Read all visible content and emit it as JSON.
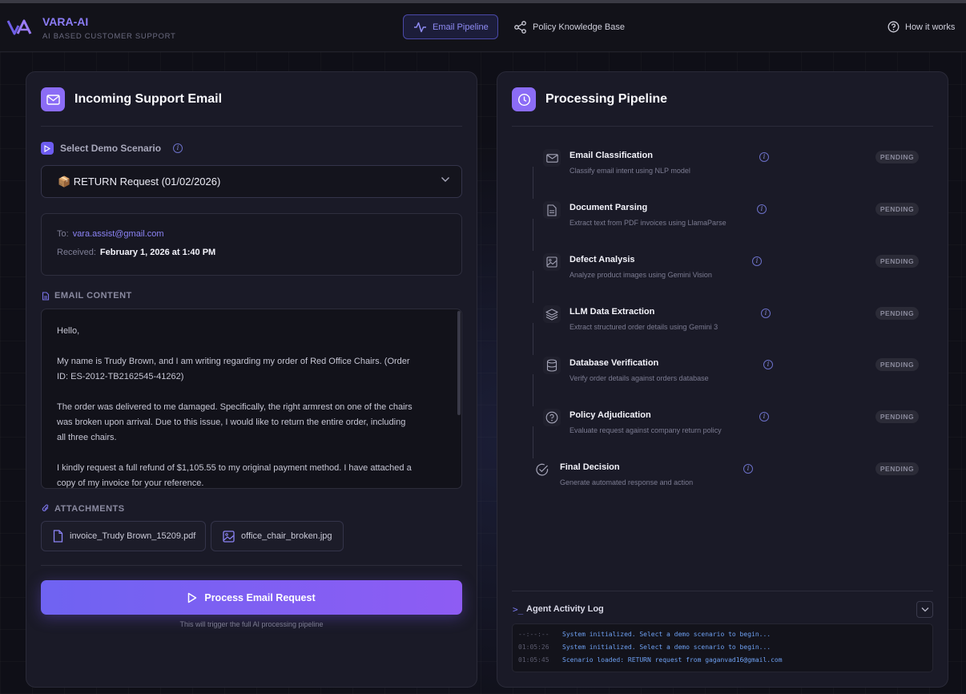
{
  "app": {
    "brand": "VARA-AI",
    "tagline": "AI BASED CUSTOMER SUPPORT",
    "nav": {
      "email_pipeline": "Email Pipeline",
      "policy_kb": "Policy Knowledge Base",
      "how_it_works": "How it works"
    }
  },
  "left": {
    "title": "Incoming Support Email",
    "scenario_label": "Select Demo Scenario",
    "scenario_selected": "📦 RETURN Request (01/02/2026)",
    "to_label": "To:",
    "to_value": "vara.assist@gmail.com",
    "received_label": "Received:",
    "received_value": "February 1, 2026 at 1:40 PM",
    "email_content_label": "EMAIL CONTENT",
    "email_paragraphs": [
      "Hello,",
      "My name is Trudy Brown, and I am writing regarding my order of Red Office Chairs. (Order ID: ES-2012-TB2162545-41262)",
      "The order was delivered to me damaged. Specifically, the right armrest on one of the chairs was broken upon arrival. Due to this issue, I would like to return the entire order, including all three chairs.",
      "I kindly request a full refund of $1,105.55 to my original payment method. I have attached a copy of my invoice for your reference."
    ],
    "attachments_label": "ATTACHMENTS",
    "attachments": [
      "invoice_Trudy Brown_15209.pdf",
      "office_chair_broken.jpg"
    ],
    "process_button": "Process Email Request",
    "process_hint": "This will trigger the full AI processing pipeline"
  },
  "right": {
    "title": "Processing Pipeline",
    "steps": [
      {
        "title": "Email Classification",
        "desc": "Classify email intent using NLP model",
        "status": "PENDING",
        "icon": "mail-icon"
      },
      {
        "title": "Document Parsing",
        "desc": "Extract text from PDF invoices using LlamaParse",
        "status": "PENDING",
        "icon": "document-icon"
      },
      {
        "title": "Defect Analysis",
        "desc": "Analyze product images using Gemini Vision",
        "status": "PENDING",
        "icon": "image-icon"
      },
      {
        "title": "LLM Data Extraction",
        "desc": "Extract structured order details using Gemini 3",
        "status": "PENDING",
        "icon": "layers-icon"
      },
      {
        "title": "Database Verification",
        "desc": "Verify order details against orders database",
        "status": "PENDING",
        "icon": "database-icon"
      },
      {
        "title": "Policy Adjudication",
        "desc": "Evaluate request against company return policy",
        "status": "PENDING",
        "icon": "question-icon"
      },
      {
        "title": "Final Decision",
        "desc": "Generate automated response and action",
        "status": "PENDING",
        "icon": "check-circle-icon"
      }
    ],
    "log_prompt": ">_",
    "log_title": "Agent Activity Log",
    "log": [
      {
        "time": "--:--:--",
        "msg": "System initialized. Select a demo scenario to begin..."
      },
      {
        "time": "01:05:26",
        "msg": "System initialized. Select a demo scenario to begin..."
      },
      {
        "time": "01:05:45",
        "msg": "Scenario loaded: RETURN request from gaganvad16@gmail.com"
      }
    ]
  }
}
